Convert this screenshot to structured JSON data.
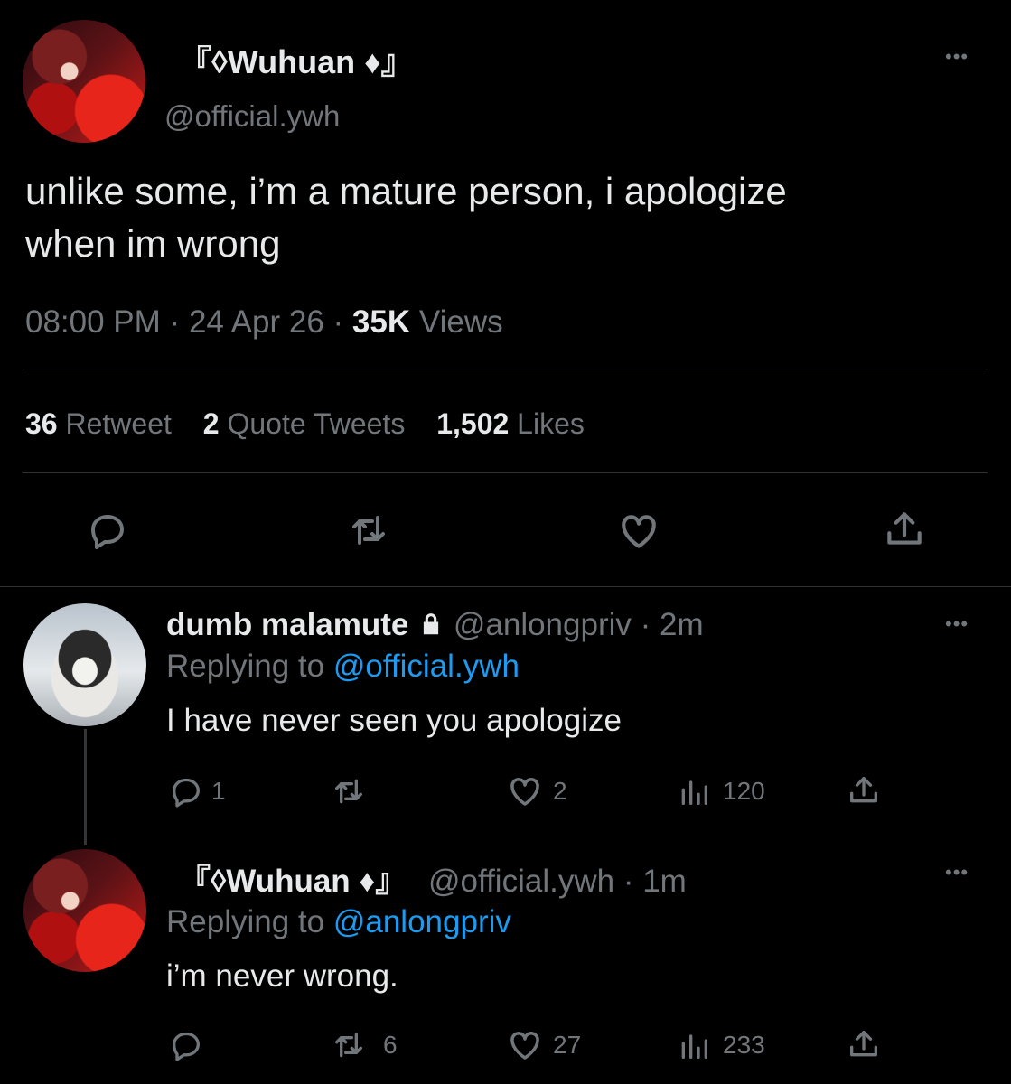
{
  "main_tweet": {
    "display_name": "『◊Wuhuan ♦』",
    "handle": "@official.ywh",
    "text_line1": "unlike some, i’m a mature person, i apologize",
    "text_line2": "when im wrong",
    "time": "08:00 PM",
    "date": "24 Apr 26",
    "views_count": "35K",
    "views_label": "Views",
    "separator": "·",
    "stats": {
      "retweet_count": "36",
      "retweet_label": "Retweet",
      "quote_count": "2",
      "quote_label": "Quote Tweets",
      "likes_count": "1,502",
      "likes_label": "Likes"
    },
    "more_glyph": "•••"
  },
  "replies": [
    {
      "display_name": "dumb malamute",
      "handle": "@anlongpriv",
      "age": "· 2m",
      "replying_prefix": "Replying to",
      "replying_handle": "@official.ywh",
      "text": "I have never seen you apologize",
      "reply_count": "1",
      "retweet_count": "",
      "like_count": "2",
      "view_count": "120"
    },
    {
      "display_name": "『◊Wuhuan ♦』",
      "handle": "@official.ywh",
      "age": "· 1m",
      "replying_prefix": "Replying to",
      "replying_handle": "@anlongpriv",
      "text": "i’m never wrong.",
      "reply_count": "",
      "retweet_count": "6",
      "like_count": "27",
      "view_count": "233"
    }
  ],
  "icons": [
    "reply-icon",
    "retweet-icon",
    "like-icon",
    "share-icon",
    "views-icon",
    "lock-icon",
    "more-icon"
  ],
  "colors": {
    "background": "#000000",
    "text": "#e7e9ea",
    "muted": "#71767b",
    "link": "#1d9bf0",
    "divider": "#2f3336"
  }
}
